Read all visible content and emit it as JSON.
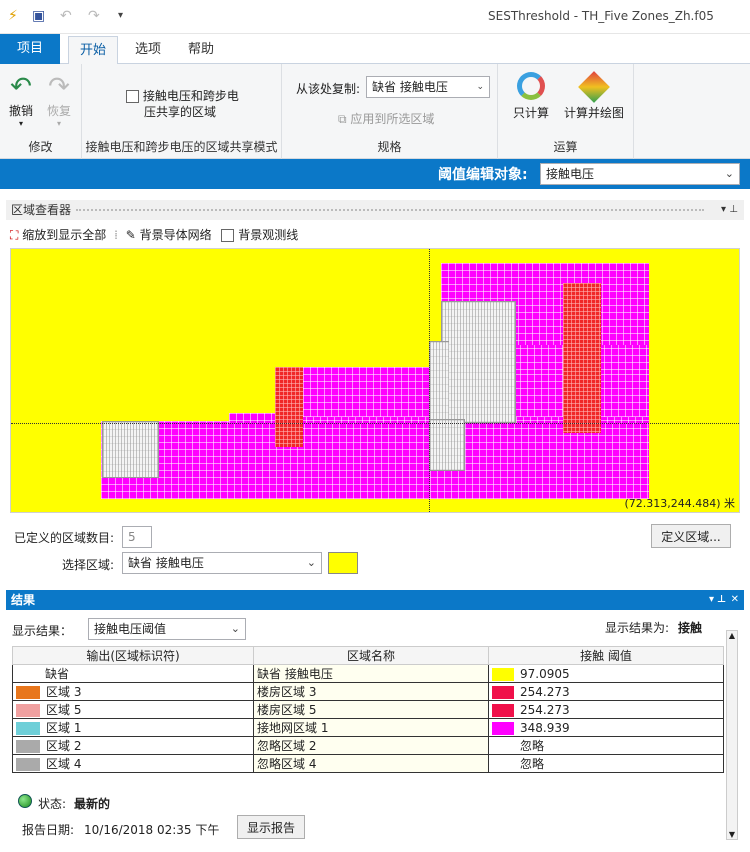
{
  "window": {
    "title": "SESThreshold - TH_Five Zones_Zh.f05"
  },
  "tabs": [
    "项目",
    "开始",
    "选项",
    "帮助"
  ],
  "ribbon": {
    "modify": {
      "undo": "撤销",
      "redo": "恢复",
      "group": "修改"
    },
    "share": {
      "checkbox_label_1": "接触电压和跨步电",
      "checkbox_label_2": "压共享的区域",
      "group": "接触电压和跨步电压的区域共享模式"
    },
    "spec": {
      "copy_from_label": "从该处复制:",
      "copy_from_value": "缺省 接触电压",
      "apply_label": "应用到所选区域",
      "group": "规格"
    },
    "compute": {
      "calc_only": "只计算",
      "calc_plot": "计算并绘图",
      "group": "运算"
    }
  },
  "edit_bar": {
    "label": "阈值编辑对象:",
    "value": "接触电压"
  },
  "zone_viewer": {
    "title": "区域查看器",
    "toolbar": {
      "zoom_all": "缩放到显示全部",
      "bg_grid": "背景导体网络",
      "bg_lines": "背景观测线"
    },
    "coord_readout": "(72.313,244.484) 米",
    "defined_count_label": "已定义的区域数目:",
    "defined_count_value": "5",
    "define_button": "定义区域...",
    "select_label": "选择区域:",
    "select_value": "缺省 接触电压",
    "select_color": "#ffff00"
  },
  "results": {
    "title": "结果",
    "display_label": "显示结果：",
    "display_value": "接触电压阈值",
    "shown_as_label": "显示结果为:",
    "shown_as_value": "接触",
    "columns": [
      "输出(区域标识符)",
      "区域名称",
      "接触 阈值"
    ],
    "rows": [
      {
        "id": "缺省",
        "color": "",
        "name": "缺省 接触电压",
        "swatch": "#ffff00",
        "value": "97.0905"
      },
      {
        "id": "区域 3",
        "color": "#e8761c",
        "name": "楼房区域 3",
        "swatch": "#f0104a",
        "value": "254.273"
      },
      {
        "id": "区域 5",
        "color": "#f0a0a0",
        "name": "楼房区域 5",
        "swatch": "#f0104a",
        "value": "254.273"
      },
      {
        "id": "区域 1",
        "color": "#6ecfd8",
        "name": "接地网区域 1",
        "swatch": "#ff00ff",
        "value": "348.939"
      },
      {
        "id": "区域 2",
        "color": "#aaaaaa",
        "name": "忽略区域 2",
        "swatch": "",
        "value": "忽略"
      },
      {
        "id": "区域 4",
        "color": "#aaaaaa",
        "name": "忽略区域 4",
        "swatch": "",
        "value": "忽略"
      }
    ],
    "status_label": "状态:",
    "status_value": "最新的",
    "report_date_label": "报告日期:",
    "report_date_value": "10/16/2018 02:35 下午",
    "show_report_button": "显示报告"
  }
}
